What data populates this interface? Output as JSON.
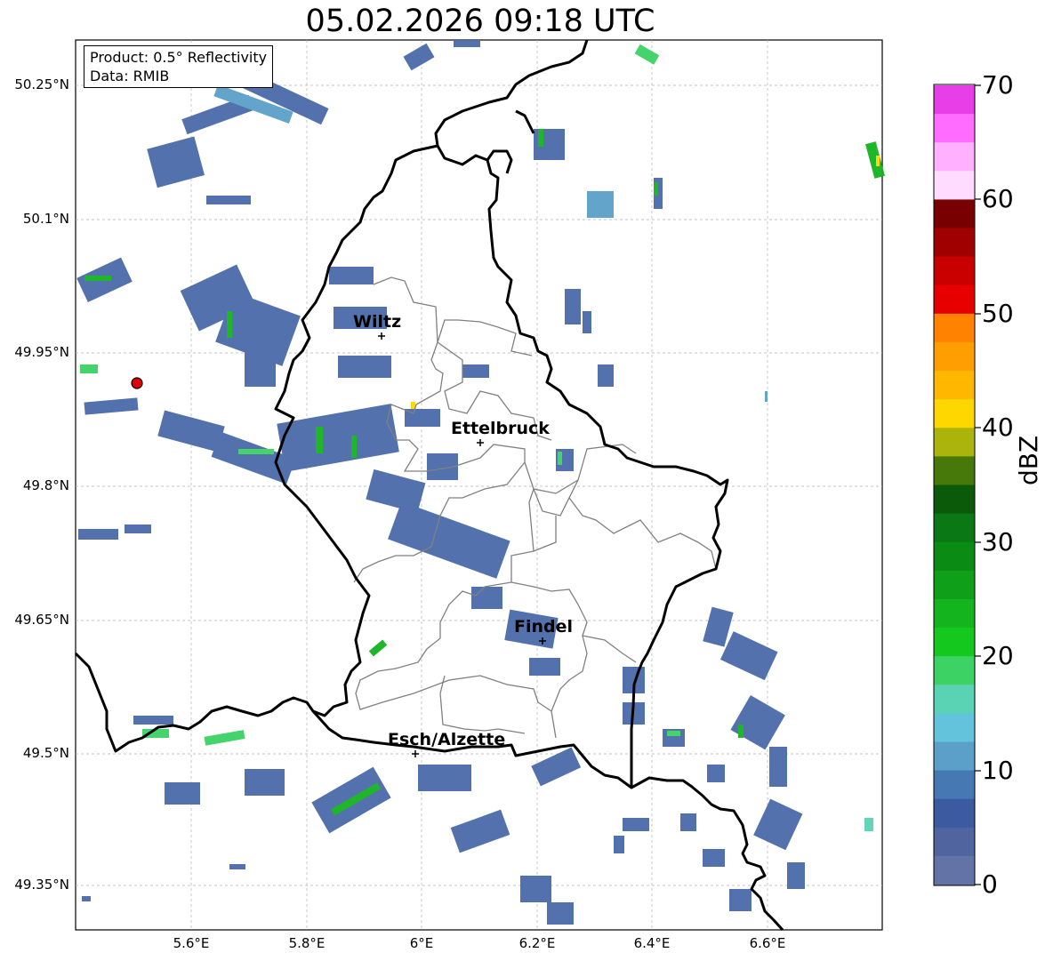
{
  "title": "05.02.2026 09:18 UTC",
  "info": {
    "product": "Product: 0.5° Reflectivity",
    "data": "Data: RMIB"
  },
  "lat_labels": [
    "50.25°N",
    "50.1°N",
    "49.95°N",
    "49.8°N",
    "49.65°N",
    "49.5°N",
    "49.35°N"
  ],
  "lon_labels": [
    "5.6°E",
    "5.8°E",
    "6°E",
    "6.2°E",
    "6.4°E",
    "6.6°E"
  ],
  "cities": [
    "Wiltz",
    "Ettelbruck",
    "Findel",
    "Esch/Alzette"
  ],
  "colorbar": {
    "label": "dBZ",
    "ticks": [
      "70",
      "60",
      "50",
      "40",
      "30",
      "20",
      "10",
      "0"
    ],
    "colors_top_to_bottom": [
      "#e83ee8",
      "#ff6cff",
      "#ffb0ff",
      "#ffdcff",
      "#780000",
      "#a00000",
      "#c80000",
      "#e60000",
      "#ff8200",
      "#ff9e00",
      "#ffb700",
      "#ffd700",
      "#aab40a",
      "#46780a",
      "#0a5a0a",
      "#0a7814",
      "#0a8c14",
      "#0f9f19",
      "#14b41e",
      "#14c81e",
      "#3cd264",
      "#5ad2b4",
      "#64c3dc",
      "#5aa0c8",
      "#4678b4",
      "#3c5aa0",
      "#5064a0",
      "#6473a5"
    ]
  },
  "radar_marker_color": "#e00000"
}
